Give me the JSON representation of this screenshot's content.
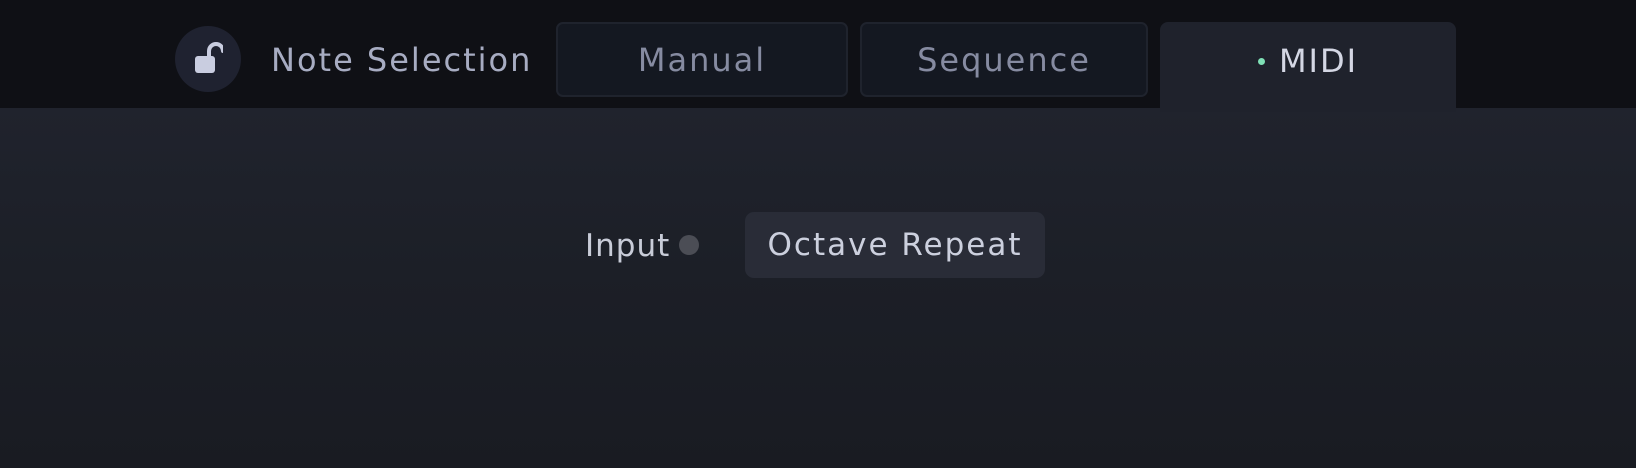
{
  "header": {
    "lock_icon": "unlock-icon",
    "title": "Note Selection",
    "tabs": [
      {
        "label": "Manual",
        "active": false
      },
      {
        "label": "Sequence",
        "active": false
      },
      {
        "label": "MIDI",
        "active": true
      }
    ]
  },
  "midi_panel": {
    "input_label": "Input",
    "octave_repeat_label": "Octave Repeat"
  },
  "colors": {
    "active_indicator": "#7fe0b6",
    "input_indicator": "#4b4d55"
  }
}
